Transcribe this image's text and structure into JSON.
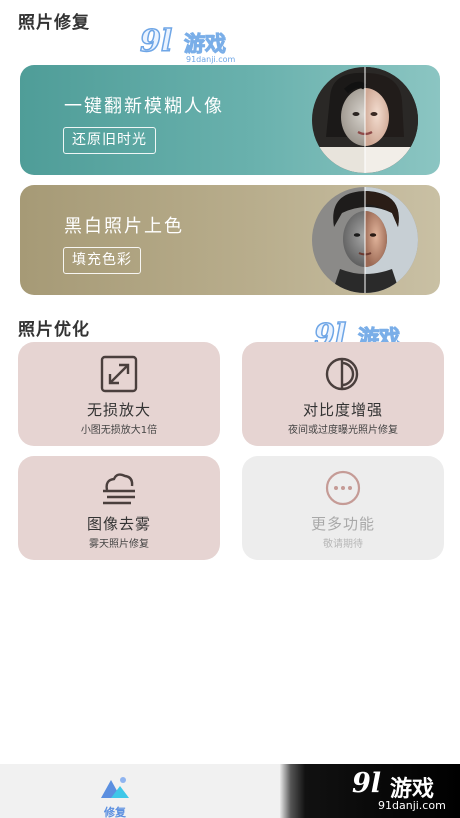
{
  "sections": {
    "repair_title": "照片修复",
    "optimize_title": "照片优化"
  },
  "watermark": {
    "number": "9l",
    "brand": "游戏",
    "domain": "91danji.com"
  },
  "banners": [
    {
      "title": "一键翻新模糊人像",
      "button": "还原旧时光",
      "color": "#5ea7a3"
    },
    {
      "title": "黑白照片上色",
      "button": "填充色彩",
      "color": "#b0a482"
    }
  ],
  "cards": [
    {
      "title": "无损放大",
      "subtitle": "小图无损放大1倍",
      "icon": "expand-icon"
    },
    {
      "title": "对比度增强",
      "subtitle": "夜间或过度曝光照片修复",
      "icon": "contrast-icon"
    },
    {
      "title": "图像去雾",
      "subtitle": "雾天照片修复",
      "icon": "fog-icon"
    },
    {
      "title": "更多功能",
      "subtitle": "敬请期待",
      "icon": "more-icon"
    }
  ],
  "tabbar": {
    "active_label": "修复",
    "accent": "#5b8fe0"
  },
  "corner_logo": {
    "number": "9l",
    "brand": "游戏",
    "domain": "91danji.com"
  }
}
